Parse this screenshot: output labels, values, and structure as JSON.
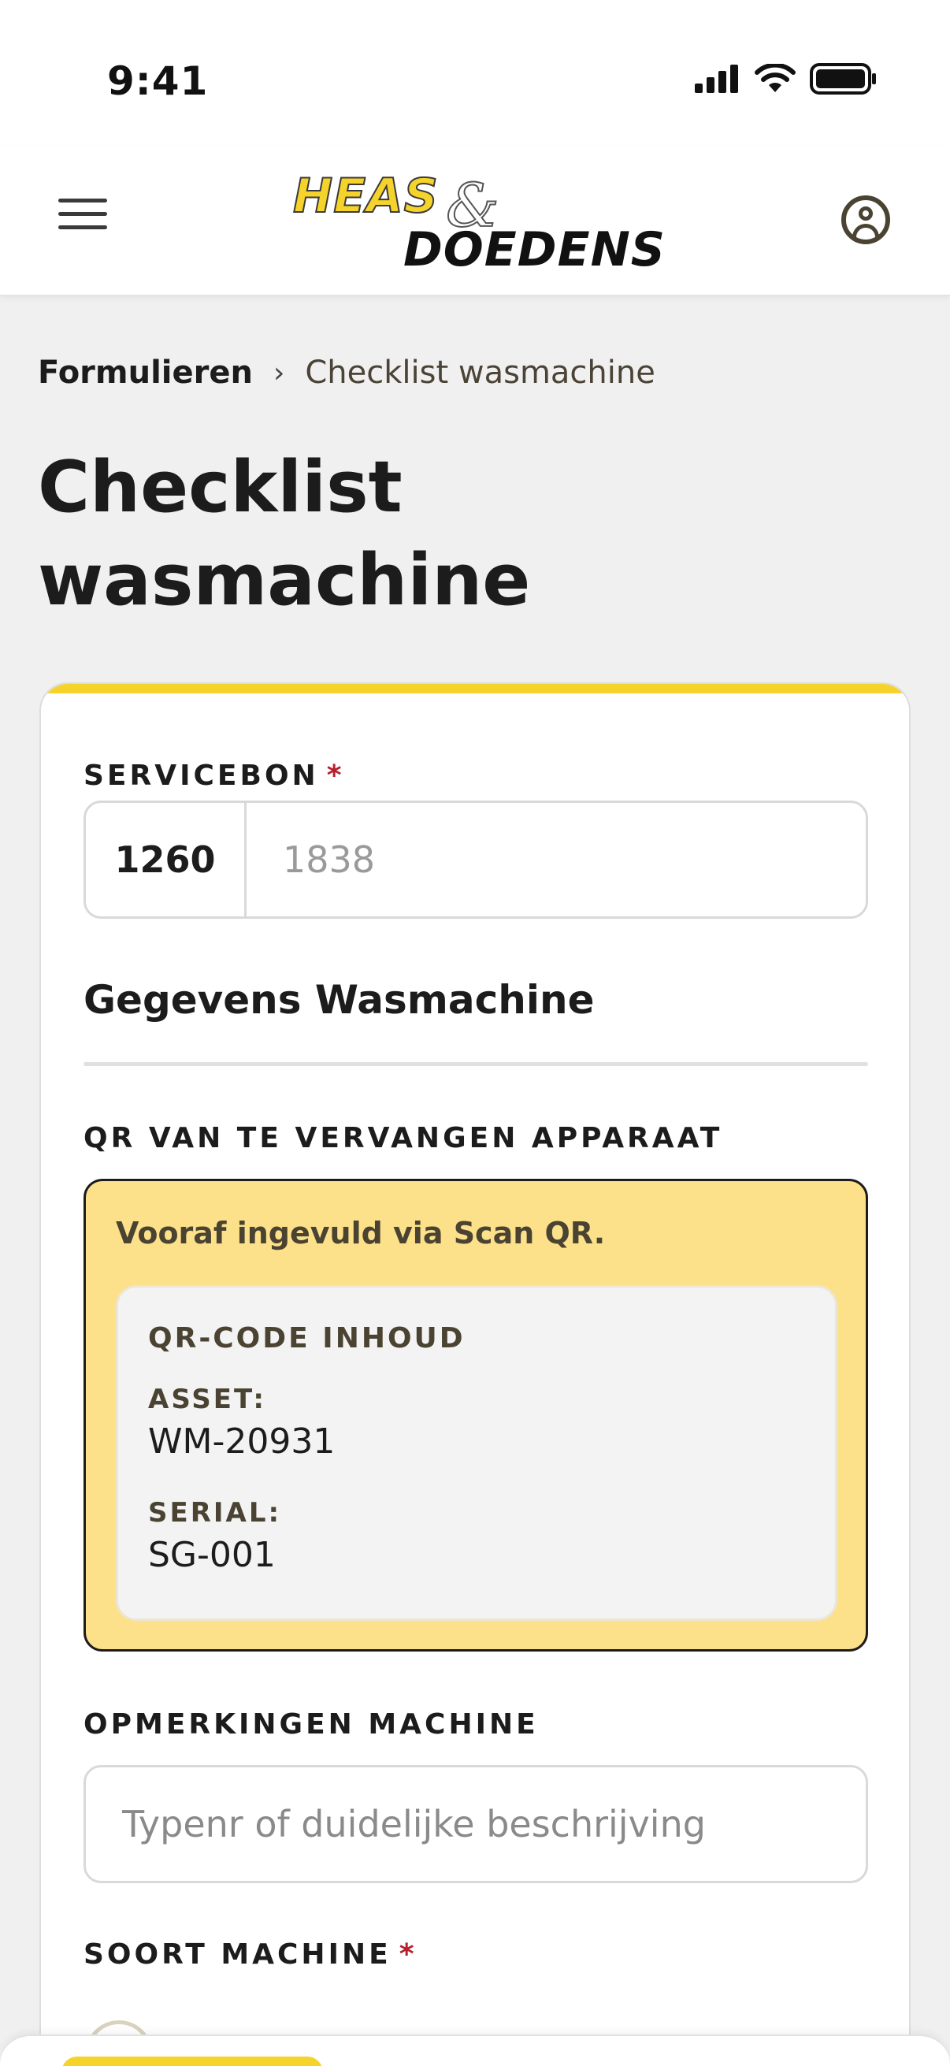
{
  "status_bar": {
    "time": "9:41"
  },
  "header": {
    "logo_line1": "HEAS",
    "logo_amp": "&",
    "logo_line2": "DOEDENS"
  },
  "breadcrumb": {
    "parent": "Formulieren",
    "separator": "›",
    "current": "Checklist wasmachine"
  },
  "page_title": "Checklist wasmachine",
  "form": {
    "servicebon": {
      "label": "SERVICEBON",
      "required": "*",
      "prefix": "1260",
      "placeholder": "1838"
    },
    "section_title": "Gegevens Wasmachine",
    "qr": {
      "label": "QR VAN TE VERVANGEN APPARAAT",
      "note": "Vooraf ingevuld via Scan QR.",
      "content_title": "QR-CODE INHOUD",
      "asset_label": "ASSET:",
      "asset_value": "WM-20931",
      "serial_label": "SERIAL:",
      "serial_value": "SG-001"
    },
    "remarks": {
      "label": "OPMERKINGEN MACHINE",
      "placeholder": "Typenr of duidelijke beschrijving"
    },
    "machine_type": {
      "label": "SOORT MACHINE",
      "required": "*"
    }
  },
  "colors": {
    "brand_yellow": "#f5d32a",
    "qr_box_bg": "#fde08a",
    "required": "#b5202c",
    "text_dark": "#1c1c1c",
    "text_brown": "#4a4332"
  }
}
